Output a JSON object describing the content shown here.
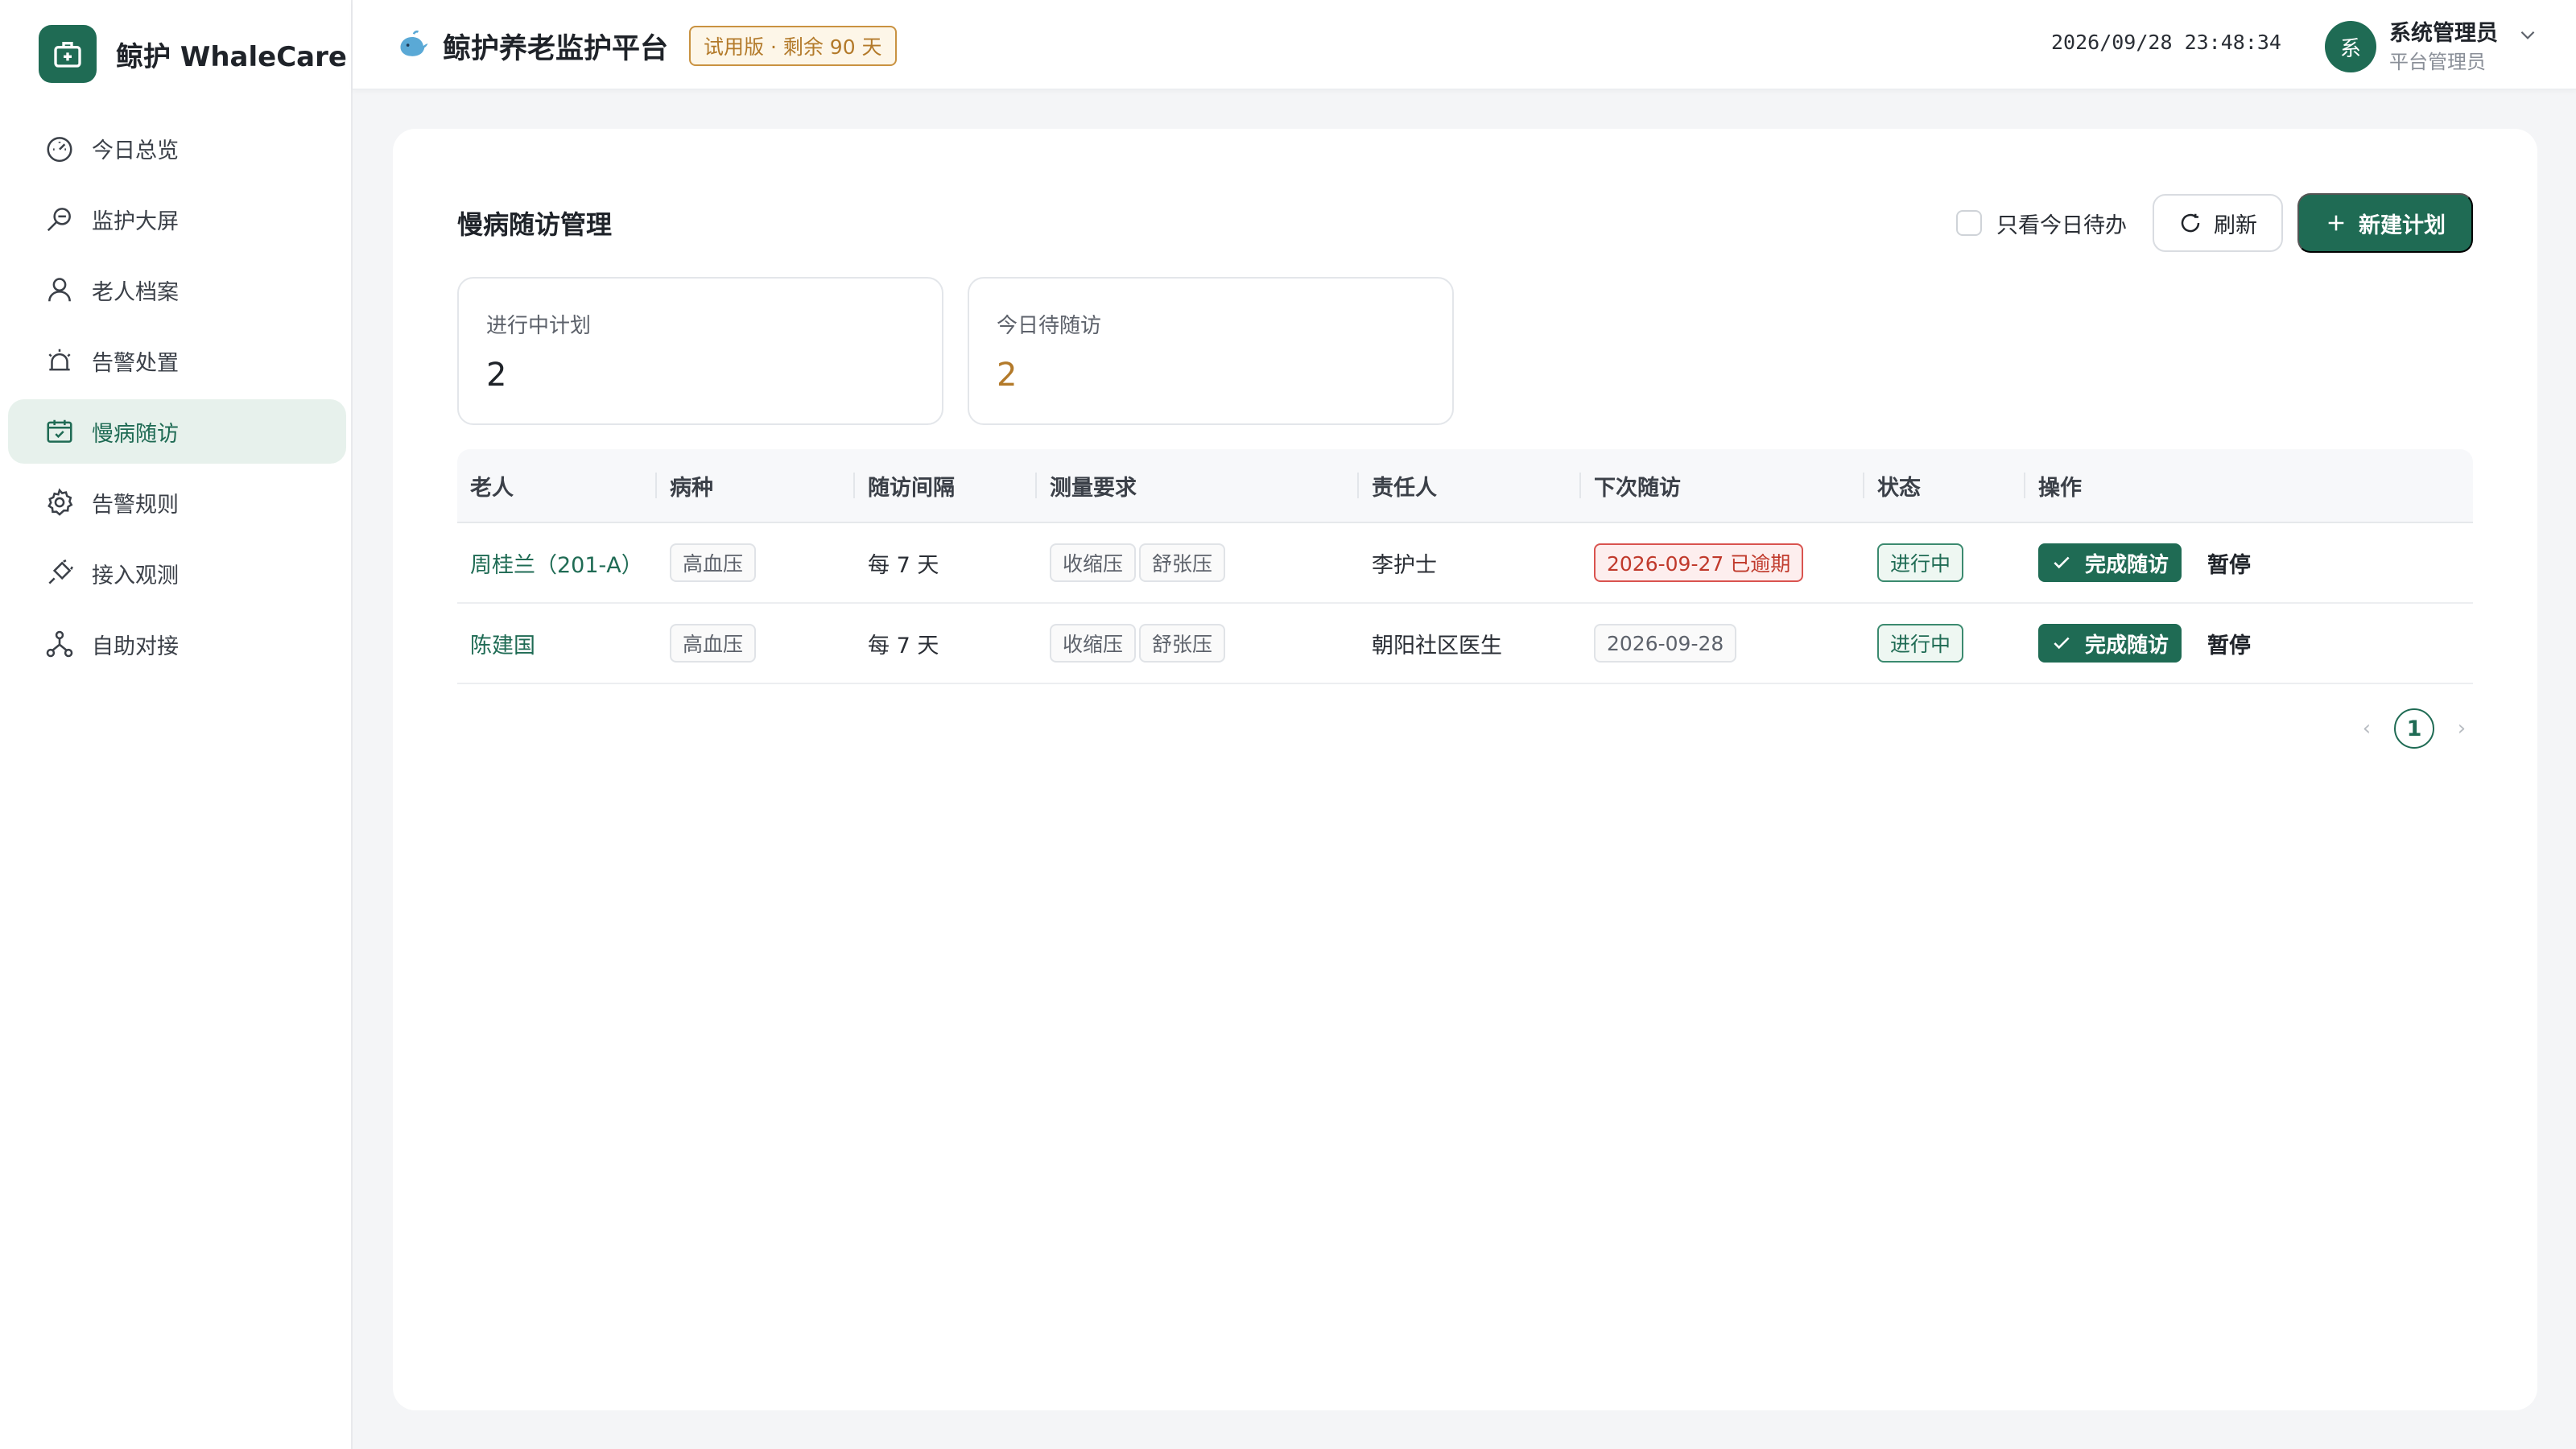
{
  "brand": {
    "name": "鲸护 WhaleCare"
  },
  "sidebar": {
    "items": [
      {
        "label": "今日总览",
        "icon": "dashboard-icon"
      },
      {
        "label": "监护大屏",
        "icon": "monitor-search-icon"
      },
      {
        "label": "老人档案",
        "icon": "user-icon"
      },
      {
        "label": "告警处置",
        "icon": "alarm-icon"
      },
      {
        "label": "慢病随访",
        "icon": "calendar-check-icon",
        "active": true
      },
      {
        "label": "告警规则",
        "icon": "gear-icon"
      },
      {
        "label": "接入观测",
        "icon": "plug-icon"
      },
      {
        "label": "自助对接",
        "icon": "network-icon"
      }
    ]
  },
  "header": {
    "title": "鲸护养老监护平台",
    "trial_badge": "试用版 · 剩余 90 天",
    "datetime": "2026/09/28 23:48:34",
    "user": {
      "avatar_text": "系",
      "name": "系统管理员",
      "role": "平台管理员"
    }
  },
  "page": {
    "title": "慢病随访管理",
    "today_only_label": "只看今日待办",
    "refresh_label": "刷新",
    "new_plan_label": "新建计划"
  },
  "stats": [
    {
      "label": "进行中计划",
      "value": "2"
    },
    {
      "label": "今日待随访",
      "value": "2"
    }
  ],
  "table": {
    "columns": [
      "老人",
      "病种",
      "随访间隔",
      "测量要求",
      "责任人",
      "下次随访",
      "状态",
      "操作"
    ],
    "rows": [
      {
        "elder": "周桂兰（201-A）",
        "disease": "高血压",
        "interval": "每 7 天",
        "measures": [
          "收缩压",
          "舒张压"
        ],
        "owner": "李护士",
        "next": "2026-09-27 已逾期",
        "overdue": true,
        "status": "进行中",
        "complete_label": "完成随访",
        "pause_label": "暂停"
      },
      {
        "elder": "陈建国",
        "disease": "高血压",
        "interval": "每 7 天",
        "measures": [
          "收缩压",
          "舒张压"
        ],
        "owner": "朝阳社区医生",
        "next": "2026-09-28",
        "overdue": false,
        "status": "进行中",
        "complete_label": "完成随访",
        "pause_label": "暂停"
      }
    ]
  },
  "pagination": {
    "current": "1"
  },
  "colors": {
    "primary": "#1f6b54",
    "warning": "#b37a2a",
    "danger": "#c0392b"
  }
}
